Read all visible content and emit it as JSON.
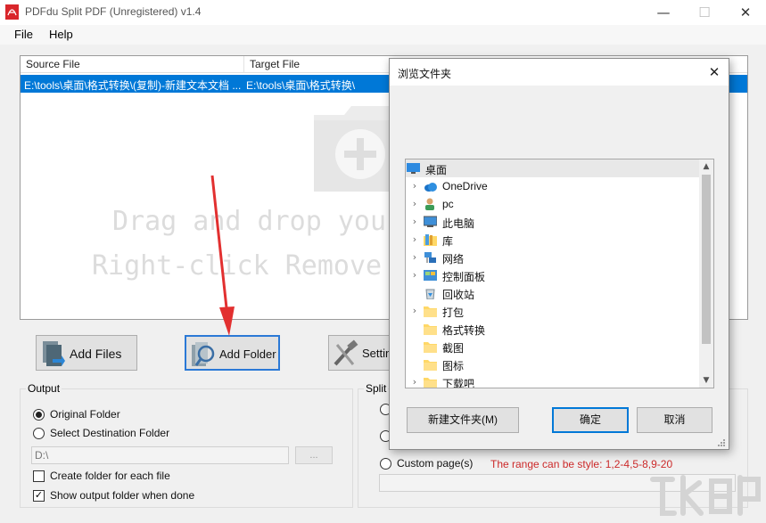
{
  "window": {
    "title": "PDFdu Split PDF (Unregistered) v1.4",
    "minimize": "—",
    "maximize": "☐",
    "close": "✕"
  },
  "menu": {
    "file": "File",
    "help": "Help"
  },
  "list": {
    "columns": [
      "Source File",
      "Target File"
    ],
    "rows": [
      {
        "source": "E:\\tools\\桌面\\格式转换\\(复制)-新建文本文档 ...",
        "target": "E:\\tools\\桌面\\格式转换\\"
      }
    ],
    "drop_hint_line1": "Drag and drop your",
    "drop_hint_line2": "Right-click Remove"
  },
  "toolbar": {
    "add_files": "Add Files",
    "add_folder": "Add Folder",
    "settings": "Settin"
  },
  "output": {
    "legend": "Output",
    "original_folder": "Original Folder",
    "select_destination": "Select Destination Folder",
    "destination_value": "D:\\",
    "browse": "...",
    "create_folder": "Create folder for each file",
    "show_output": "Show output folder when done",
    "selected": "original_folder",
    "create_folder_checked": false,
    "show_output_checked": true
  },
  "split": {
    "legend": "Split",
    "custom_pages": "Custom page(s)",
    "hint": "The range can be style:  1,2-4,5-8,9-20",
    "hint_color": "#cc2a2a"
  },
  "dialog": {
    "title": "浏览文件夹",
    "close": "✕",
    "tree": [
      {
        "label": "桌面",
        "icon": "desktop-icon",
        "expandable": false,
        "indent": 0,
        "selected": true
      },
      {
        "label": "OneDrive",
        "icon": "cloud-icon",
        "expandable": true,
        "indent": 1
      },
      {
        "label": "pc",
        "icon": "user-icon",
        "expandable": true,
        "indent": 1
      },
      {
        "label": "此电脑",
        "icon": "computer-icon",
        "expandable": true,
        "indent": 1
      },
      {
        "label": "库",
        "icon": "library-icon",
        "expandable": true,
        "indent": 1
      },
      {
        "label": "网络",
        "icon": "network-icon",
        "expandable": true,
        "indent": 1
      },
      {
        "label": "控制面板",
        "icon": "control-panel-icon",
        "expandable": true,
        "indent": 1
      },
      {
        "label": "回收站",
        "icon": "recycle-bin-icon",
        "expandable": false,
        "indent": 1
      },
      {
        "label": "打包",
        "icon": "folder-icon",
        "expandable": true,
        "indent": 1
      },
      {
        "label": "格式转换",
        "icon": "folder-icon",
        "expandable": false,
        "indent": 1
      },
      {
        "label": "截图",
        "icon": "folder-icon",
        "expandable": false,
        "indent": 1
      },
      {
        "label": "图标",
        "icon": "folder-icon",
        "expandable": false,
        "indent": 1
      },
      {
        "label": "下载吧",
        "icon": "folder-icon",
        "expandable": true,
        "indent": 1
      }
    ],
    "new_folder": "新建文件夹(M)",
    "ok": "确定",
    "cancel": "取消"
  },
  "colors": {
    "selection": "#0078d7",
    "accent_border": "#2b79d6",
    "arrow": "#e23030",
    "folder": "#ffd867"
  },
  "icons": {
    "app": "pdf-icon",
    "drop_zone": "folder-add-icon",
    "add_files": "add-files-icon",
    "add_folder": "add-folder-icon",
    "settings": "tools-icon"
  }
}
